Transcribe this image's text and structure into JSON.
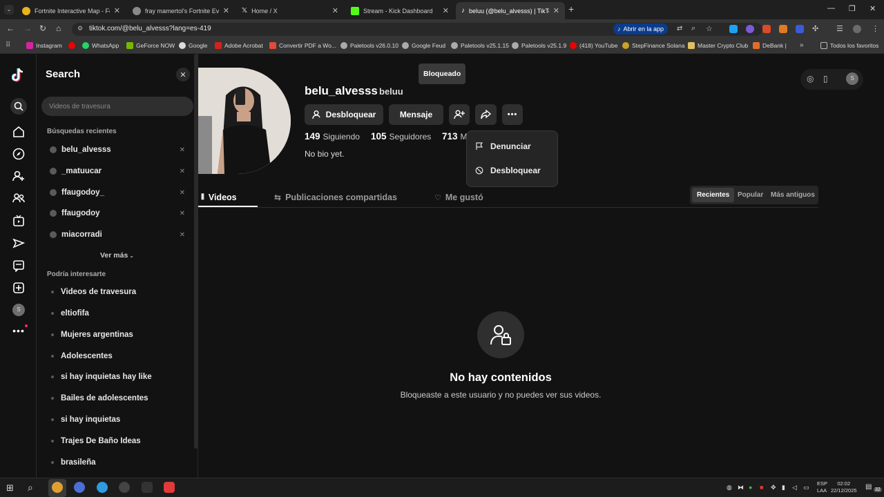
{
  "browser": {
    "tabs": [
      {
        "title": "Fortnite Interactive Map - Fortn",
        "color": "#e8b31a"
      },
      {
        "title": "fray mamertol's Fortnite Events",
        "color": "#cfcfcf"
      },
      {
        "title": "Home / X",
        "color": "#ffffff"
      },
      {
        "title": "Stream - Kick Dashboard",
        "color": "#53fc18"
      },
      {
        "title": "beluu (@belu_alvesss) | TikTok",
        "color": "#ffffff"
      }
    ],
    "url": "tiktok.com/@belu_alvesss?lang=es-419",
    "open_app_label": "Abrir en la app",
    "bookmarks": [
      "Instagram",
      "",
      "WhatsApp",
      "GeForce NOW",
      "Google",
      "Adobe Acrobat",
      "Convertir PDF a Wo...",
      "Paletools v26.0.10",
      "Google Feud",
      "Paletools v25.1.15",
      "Paletools v25.1.9",
      "(418) YouTube",
      "StepFinance Solana",
      "Master Crypto Club",
      "DeBank |"
    ],
    "all_bookmarks_label": "Todos los favoritos"
  },
  "search_panel": {
    "title": "Search",
    "placeholder": "Videos de travesura",
    "recent_header": "Búsquedas recientes",
    "recent": [
      "belu_alvesss",
      "_matuucar",
      "ffaugodoy_",
      "ffaugodoy",
      "miacorradi"
    ],
    "see_more": "Ver más",
    "suggest_header": "Podría interesarte",
    "suggestions": [
      "Videos de travesura",
      "eltiofifa",
      "Mujeres argentinas",
      "Adolescentes",
      "si hay inquietas hay like",
      "Bailes de adolescentes",
      "si hay inquietas",
      "Trajes De Baño Ideas",
      "brasileña"
    ]
  },
  "profile": {
    "username": "belu_alvesss",
    "nickname": "beluu",
    "blocked_badge": "Bloqueado",
    "unblock_button": "Desbloquear",
    "message_button": "Mensaje",
    "stats": [
      {
        "value": "149",
        "label": "Siguiendo"
      },
      {
        "value": "105",
        "label": "Seguidores"
      },
      {
        "value": "713",
        "label": "M"
      }
    ],
    "bio": "No bio yet.",
    "menu": [
      "Denunciar",
      "Desbloquear"
    ],
    "tabs": [
      "Videos",
      "Publicaciones compartidas",
      "Me gustó"
    ],
    "sort": [
      "Recientes",
      "Popular",
      "Más antiguos"
    ],
    "empty_title": "No hay contenidos",
    "empty_subtitle": "Bloqueaste a este usuario y no puedes ver sus videos."
  },
  "taskbar": {
    "lang": "ESP",
    "lang2": "LAA",
    "time": "02:02",
    "date": "22/12/2025",
    "notif_count": "32"
  }
}
